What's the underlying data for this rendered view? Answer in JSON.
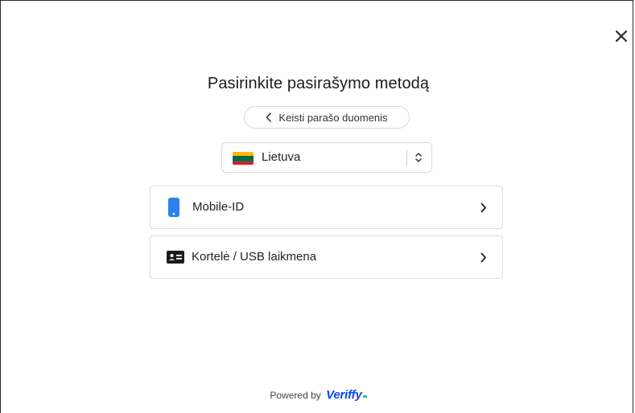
{
  "dialog": {
    "title": "Pasirinkite pasirašymo metodą",
    "back_label": "Keisti parašo duomenis",
    "close_icon": "close-icon"
  },
  "country_select": {
    "value": "Lietuva",
    "flag_colors": [
      "#fdb913",
      "#006a44",
      "#c1272d"
    ],
    "icon": "chevron-up-down-icon"
  },
  "methods": [
    {
      "label": "Mobile-ID",
      "icon": "mobile-phone-icon",
      "color": "#2f80ed"
    },
    {
      "label": "Kortelė / USB laikmena",
      "icon": "id-card-icon",
      "color": "#1c1c1c"
    }
  ],
  "footer": {
    "powered_by": "Powered by",
    "brand": "Veriffy",
    "brand_color": "#0a45e8",
    "brand_accent": "#19c39b"
  }
}
